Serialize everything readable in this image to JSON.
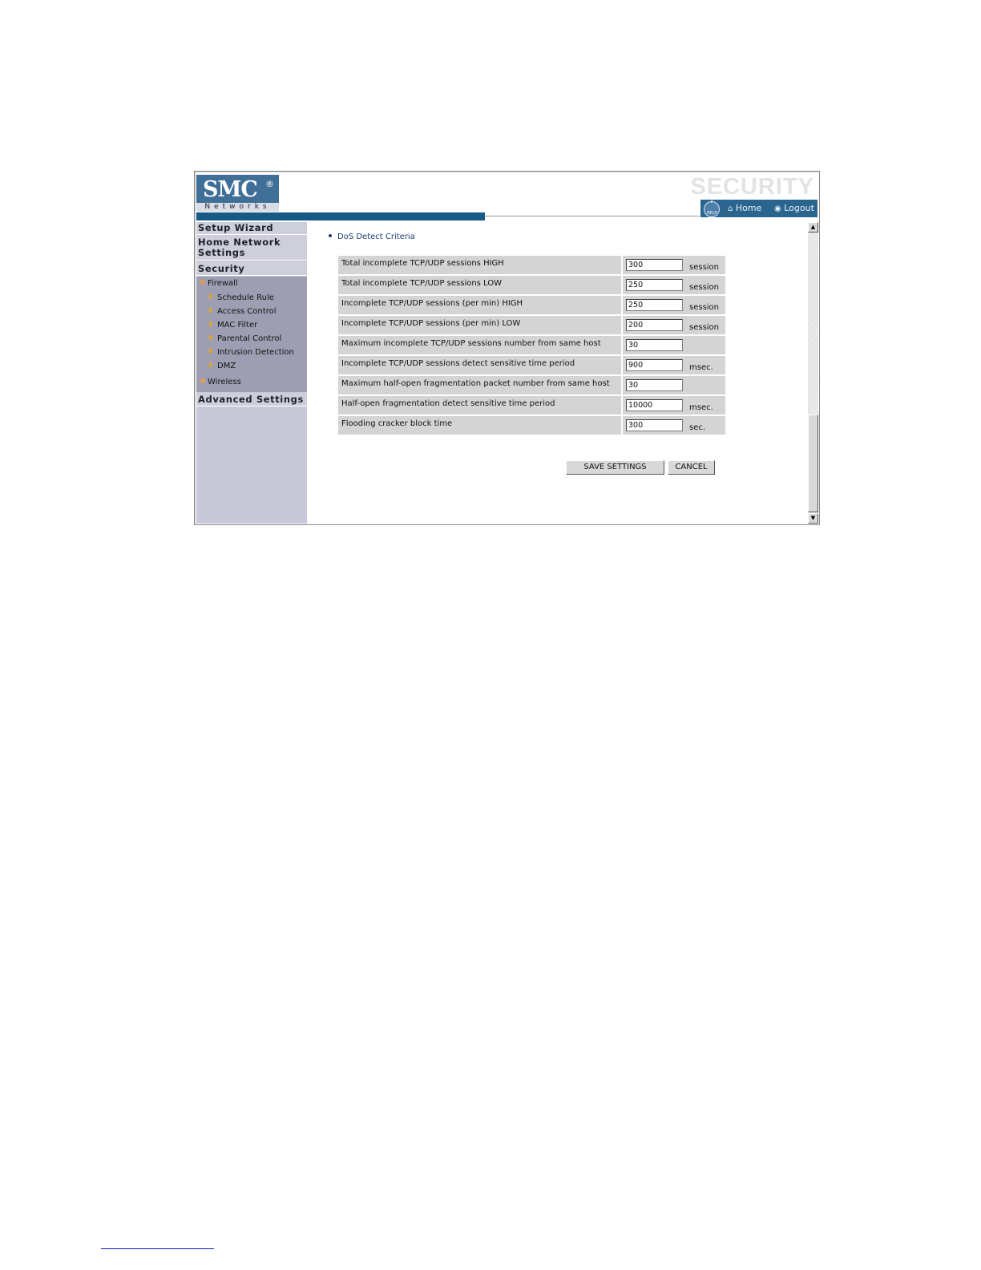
{
  "header": {
    "logo_text": "SMC",
    "logo_reg": "®",
    "logo_sub": "Networks",
    "section_brand": "SECURITY",
    "help_icon_label": "HELP",
    "nav_home": "Home",
    "nav_logout": "Logout"
  },
  "sidebar": {
    "setup_wizard": "Setup Wizard",
    "home_network_1": "Home Network",
    "home_network_2": "Settings",
    "security": "Security",
    "firewall": "Firewall",
    "firewall_items": [
      "Schedule Rule",
      "Access Control",
      "MAC Filter",
      "Parental Control",
      "Intrusion Detection",
      "DMZ"
    ],
    "wireless": "Wireless",
    "advanced_settings": "Advanced Settings"
  },
  "main": {
    "section_title": "DoS Detect Criteria",
    "rows": [
      {
        "label": "Total incomplete TCP/UDP sessions HIGH",
        "value": "300",
        "unit": "session"
      },
      {
        "label": "Total incomplete TCP/UDP sessions LOW",
        "value": "250",
        "unit": "session"
      },
      {
        "label": "Incomplete TCP/UDP sessions (per min) HIGH",
        "value": "250",
        "unit": "session"
      },
      {
        "label": "Incomplete TCP/UDP sessions (per min) LOW",
        "value": "200",
        "unit": "session"
      },
      {
        "label": "Maximum incomplete TCP/UDP sessions number from same host",
        "value": "30",
        "unit": ""
      },
      {
        "label": "Incomplete TCP/UDP sessions detect sensitive time period",
        "value": "900",
        "unit": "msec."
      },
      {
        "label": "Maximum half-open fragmentation packet number from same host",
        "value": "30",
        "unit": ""
      },
      {
        "label": "Half-open fragmentation detect sensitive time period",
        "value": "10000",
        "unit": "msec."
      },
      {
        "label": "Flooding cracker block time",
        "value": "300",
        "unit": "sec."
      }
    ],
    "save_label": "SAVE SETTINGS",
    "cancel_label": "CANCEL"
  },
  "scrollbar": {
    "up_arrow": "▲",
    "down_arrow": "▼"
  }
}
